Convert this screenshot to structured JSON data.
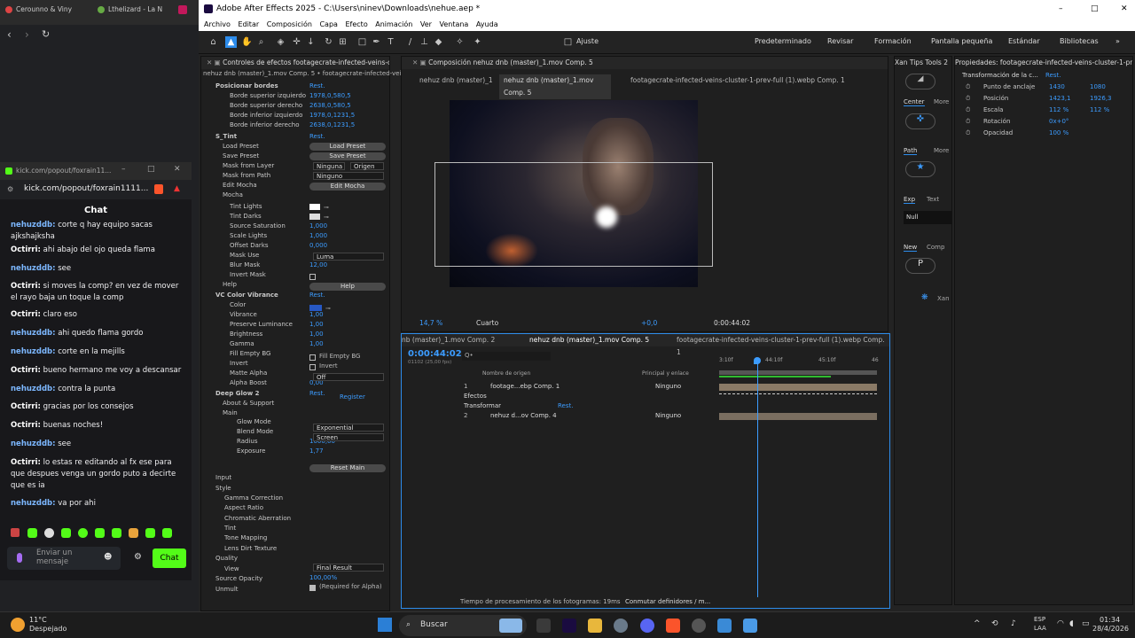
{
  "browser": {
    "tabs": [
      "Cerounno & Viny",
      "Lthelizard - La N"
    ],
    "url": "kick.com/popout/foxrain1111...",
    "popup_title": "kick.com/popout/foxrain11..."
  },
  "chat": {
    "title": "Chat",
    "input_placeholder": "Enviar un mensaje",
    "send_label": "Chat",
    "messages": [
      {
        "user": "nehuzddb:",
        "text": "corte q hay equipo sacas ajkshajksha",
        "color": "#7cb7ff"
      },
      {
        "user": "Octirri:",
        "text": "ahi abajo del ojo queda flama",
        "color": "#ffffff"
      },
      {
        "user": "nehuzddb:",
        "text": "see",
        "color": "#7cb7ff"
      },
      {
        "user": "Octirri:",
        "text": "si moves la comp? en vez de mover el rayo baja un toque la comp",
        "color": "#ffffff"
      },
      {
        "user": "Octirri:",
        "text": "claro eso",
        "color": "#ffffff"
      },
      {
        "user": "nehuzddb:",
        "text": "ahi quedo flama gordo",
        "color": "#7cb7ff"
      },
      {
        "user": "nehuzddb:",
        "text": "corte en la mejills",
        "color": "#7cb7ff"
      },
      {
        "user": "Octirri:",
        "text": "bueno hermano me voy a descansar",
        "color": "#ffffff"
      },
      {
        "user": "nehuzddb:",
        "text": "contra la punta",
        "color": "#7cb7ff"
      },
      {
        "user": "Octirri:",
        "text": "gracias por los consejos",
        "color": "#ffffff"
      },
      {
        "user": "Octirri:",
        "text": "buenas noches!",
        "color": "#ffffff"
      },
      {
        "user": "nehuzddb:",
        "text": "see",
        "color": "#7cb7ff"
      },
      {
        "user": "Octirri:",
        "text": "lo estas re editando al fx ese para que despues venga un gordo puto a decirte que es ia",
        "color": "#ffffff"
      },
      {
        "user": "nehuzddb:",
        "text": "va por ahi",
        "color": "#7cb7ff"
      }
    ]
  },
  "ae": {
    "title": "Adobe After Effects 2025 - C:\\Users\\ninev\\Downloads\\nehue.aep *",
    "menu": [
      "Archivo",
      "Editar",
      "Composición",
      "Capa",
      "Efecto",
      "Animación",
      "Ver",
      "Ventana",
      "Ayuda"
    ],
    "toolbar": {
      "snap_label": "Ajuste",
      "workspaces": [
        "Predeterminado",
        "Revisar",
        "Formación",
        "Pantalla pequeña",
        "Estándar",
        "Bibliotecas"
      ]
    },
    "effects": {
      "tab": "Controles de efectos footagecrate-infected-veins-clu",
      "breadcrumb": "nehuz dnb (master)_1.mov Comp. 5 • footagecrate-infected-veins-clu",
      "rows": [
        {
          "label": "Posicionar bordes",
          "value": "Rest.",
          "indent": 0,
          "fx": true
        },
        {
          "label": "Borde superior izquierdo",
          "value": "1978,0,580,5",
          "indent": 2
        },
        {
          "label": "Borde superior derecho",
          "value": "2638,0,580,5",
          "indent": 2
        },
        {
          "label": "Borde inferior izquierdo",
          "value": "1978,0,1231,5",
          "indent": 2
        },
        {
          "label": "Borde inferior derecho",
          "value": "2638,0,1231,5",
          "indent": 2
        },
        {
          "label": "S_Tint",
          "value": "Rest.",
          "indent": 0,
          "fx": true
        },
        {
          "label": "Load Preset",
          "value": "",
          "indent": 1
        },
        {
          "label": "Save Preset",
          "value": "",
          "indent": 1
        },
        {
          "label": "Mask from Layer",
          "value": "",
          "indent": 1
        },
        {
          "label": "Mask from Path",
          "value": "",
          "indent": 1
        },
        {
          "label": "Edit Mocha",
          "value": "",
          "indent": 1
        },
        {
          "label": "Mocha",
          "value": "",
          "indent": 1
        },
        {
          "label": "Tint Lights",
          "value": "",
          "indent": 2
        },
        {
          "label": "Tint Darks",
          "value": "",
          "indent": 2
        },
        {
          "label": "Source Saturation",
          "value": "1,000",
          "indent": 2
        },
        {
          "label": "Scale Lights",
          "value": "1,000",
          "indent": 2
        },
        {
          "label": "Offset Darks",
          "value": "0,000",
          "indent": 2
        },
        {
          "label": "Mask Use",
          "value": "",
          "indent": 2
        },
        {
          "label": "Blur Mask",
          "value": "12,00",
          "indent": 2
        },
        {
          "label": "Invert Mask",
          "value": "",
          "indent": 2
        },
        {
          "label": "Help",
          "value": "",
          "indent": 1
        },
        {
          "label": "VC Color Vibrance",
          "value": "Rest.",
          "indent": 0,
          "fx": true
        },
        {
          "label": "Color",
          "value": "",
          "indent": 2
        },
        {
          "label": "Vibrance",
          "value": "1,00",
          "indent": 2
        },
        {
          "label": "Preserve Luminance",
          "value": "1,00",
          "indent": 2
        },
        {
          "label": "Brightness",
          "value": "1,00",
          "indent": 2
        },
        {
          "label": "Gamma",
          "value": "1,00",
          "indent": 2
        },
        {
          "label": "Fill Empty BG",
          "value": "",
          "indent": 2
        },
        {
          "label": "Invert",
          "value": "",
          "indent": 2
        },
        {
          "label": "Matte Alpha",
          "value": "",
          "indent": 2
        },
        {
          "label": "Alpha Boost",
          "value": "0,00",
          "indent": 2
        },
        {
          "label": "Deep Glow 2",
          "value": "Rest.",
          "indent": 0,
          "fx": true
        },
        {
          "label": "About & Support",
          "value": "",
          "indent": 1
        },
        {
          "label": "Main",
          "value": "",
          "indent": 1
        },
        {
          "label": "Glow Mode",
          "value": "",
          "indent": 3
        },
        {
          "label": "Blend Mode",
          "value": "",
          "indent": 3
        },
        {
          "label": "Radius",
          "value": "1000,00",
          "indent": 3
        },
        {
          "label": "Exposure",
          "value": "1,77",
          "indent": 3
        }
      ],
      "buttons": {
        "load": "Load Preset",
        "save": "Save Preset",
        "edit_mocha": "Edit Mocha",
        "help": "Help",
        "reset_main": "Reset Main"
      },
      "dropdowns": {
        "layer": "Ninguna",
        "origin": "Origen",
        "path": "Ninguno",
        "mask_use": "Luma",
        "matte": "Off",
        "glow_mode": "Exponential",
        "blend": "Screen",
        "view": "Final Result"
      },
      "checkbox_labels": {
        "fill": "Fill Empty BG",
        "invert": "Invert",
        "alpha": "(Required for Alpha)"
      },
      "register": "Register",
      "lower": [
        "Input",
        "Style",
        "Gamma Correction",
        "Aspect Ratio",
        "Chromatic Aberration",
        "Tint",
        "Tone Mapping",
        "Lens Dirt Texture",
        "Quality",
        "View",
        "Source Opacity",
        "Unmult"
      ],
      "source_opacity": "100,00%"
    },
    "comp": {
      "tab": "Composición nehuz dnb (master)_1.mov Comp. 5",
      "subtabs": [
        "nehuz dnb (master)_1",
        "nehuz dnb (master)_1.mov Comp. 5",
        "footagecrate-infected-veins-cluster-1-prev-full (1).webp Comp. 1"
      ],
      "zoom": "14,7 %",
      "quality": "Cuarto",
      "exposure": "+0,0",
      "timecode": "0:00:44:02"
    },
    "timeline": {
      "tabs": [
        "nb (master)_1.mov Comp. 2",
        "nehuz dnb (master)_1.mov Comp. 5",
        "footagecrate-infected-veins-cluster-1-prev-full (1).webp Comp. 1"
      ],
      "timecode": "0:00:44:02",
      "frames": "01102 (25,00 fps)",
      "search": "Q•",
      "col_source": "Nombre de origen",
      "col_parent": "Principal y enlace",
      "ruler": [
        "3:10f",
        "44:10f",
        "45:10f",
        "46"
      ],
      "layers": [
        {
          "num": "1",
          "name": "footage...ebp Comp. 1",
          "parent": "Ninguno"
        },
        {
          "num": "",
          "name": "Efectos",
          "parent": ""
        },
        {
          "num": "",
          "name": "Transformar",
          "parent": "Rest."
        },
        {
          "num": "2",
          "name": "nehuz d...ov Comp. 4",
          "parent": "Ninguno"
        }
      ],
      "footer": "Tiempo de procesamiento de los fotogramas: 19ms",
      "footer2": "Conmutar definidores / m..."
    },
    "xan": {
      "tab": "Xan Tips Tools 2",
      "center": "Center",
      "more": "More",
      "path": "Path",
      "exp": "Exp",
      "text": "Text",
      "null": "Null",
      "new": "New",
      "comp": "Comp",
      "xan": "Xan"
    },
    "props": {
      "tab": "Propiedades: footagecrate-infected-veins-cluster-1-pre",
      "section": "Transformación de la c...",
      "reset": "Rest.",
      "rows": [
        {
          "label": "Punto de anclaje",
          "v1": "1430",
          "v2": "1080"
        },
        {
          "label": "Posición",
          "v1": "1423,1",
          "v2": "1926,3"
        },
        {
          "label": "Escala",
          "v1": "112 %",
          "v2": "112 %"
        },
        {
          "label": "Rotación",
          "v1": "0x+0°",
          "v2": ""
        },
        {
          "label": "Opacidad",
          "v1": "100 %",
          "v2": ""
        }
      ]
    }
  },
  "taskbar": {
    "weather": "11°C",
    "weather_desc": "Despejado",
    "search": "Buscar",
    "lang1": "ESP",
    "lang2": "LAA",
    "time": "01:34",
    "date": "28/4/2026"
  }
}
